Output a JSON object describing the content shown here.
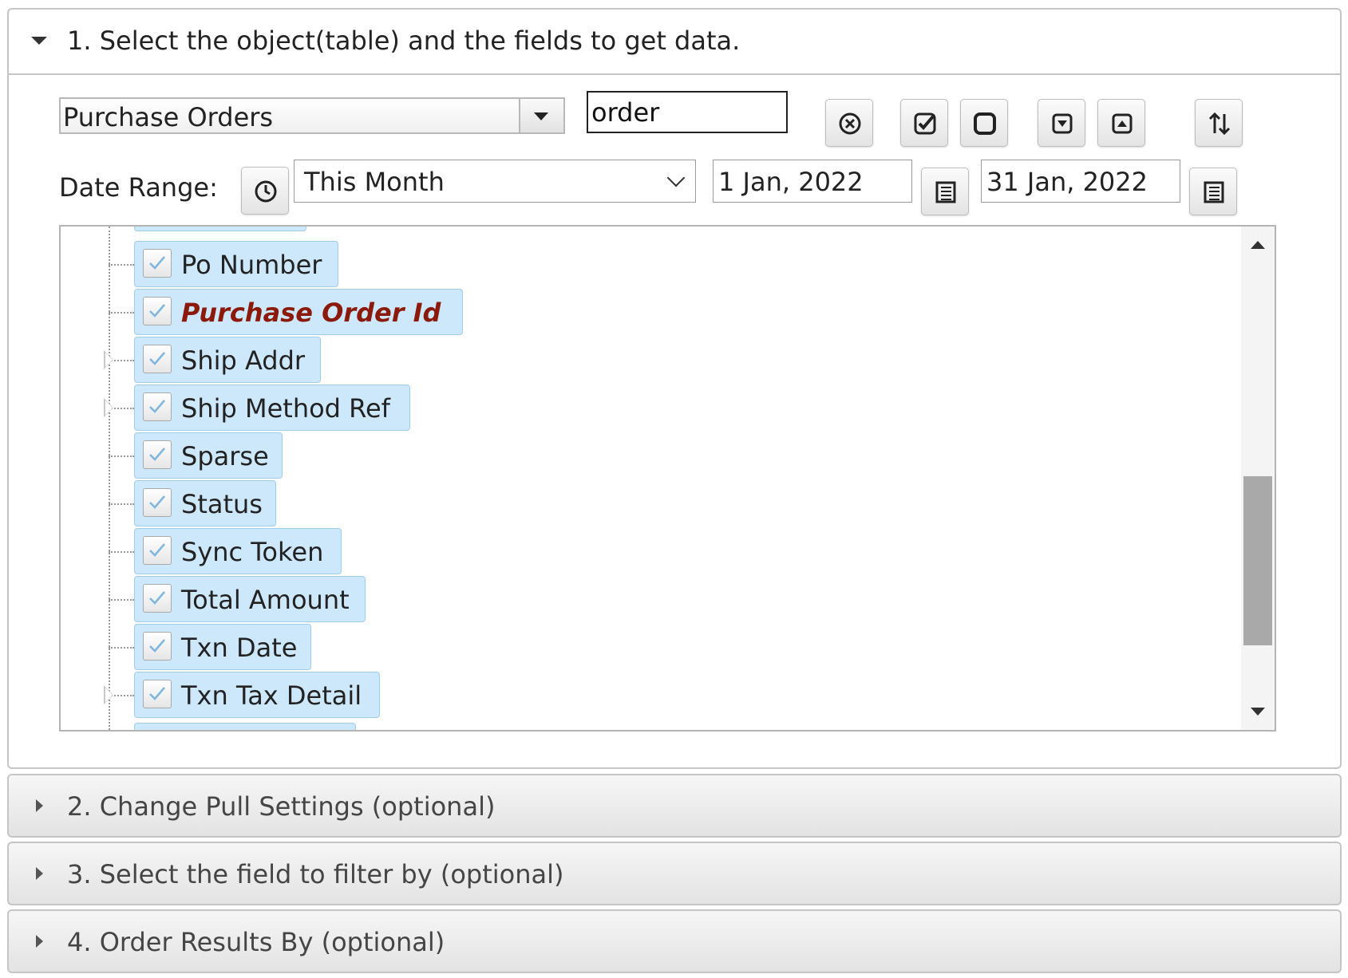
{
  "sections": [
    {
      "title": "1. Select the object(table) and the fields to get data."
    },
    {
      "title": "2. Change Pull Settings (optional)"
    },
    {
      "title": "3. Select the field to filter by (optional)"
    },
    {
      "title": "4. Order Results By (optional)"
    }
  ],
  "object_select": {
    "value": "Purchase Orders"
  },
  "search": {
    "value": "order"
  },
  "date_range": {
    "label": "Date Range:",
    "preset": "This Month",
    "start": "1 Jan, 2022",
    "end": "31 Jan, 2022"
  },
  "toolbar_icons": [
    "clear-search-icon",
    "check-all-icon",
    "uncheck-all-icon",
    "collapse-all-icon",
    "expand-all-icon",
    "sort-icon"
  ],
  "fields": [
    {
      "label": "Po Number",
      "checked": true,
      "expandable": false,
      "key": false
    },
    {
      "label": "Purchase Order Id",
      "checked": true,
      "expandable": false,
      "key": true
    },
    {
      "label": "Ship Addr",
      "checked": true,
      "expandable": true,
      "key": false
    },
    {
      "label": "Ship Method Ref",
      "checked": true,
      "expandable": true,
      "key": false
    },
    {
      "label": "Sparse",
      "checked": true,
      "expandable": false,
      "key": false
    },
    {
      "label": "Status",
      "checked": true,
      "expandable": false,
      "key": false
    },
    {
      "label": "Sync Token",
      "checked": true,
      "expandable": false,
      "key": false
    },
    {
      "label": "Total Amount",
      "checked": true,
      "expandable": false,
      "key": false
    },
    {
      "label": "Txn Date",
      "checked": true,
      "expandable": false,
      "key": false
    },
    {
      "label": "Txn Tax Detail",
      "checked": true,
      "expandable": true,
      "key": false
    }
  ],
  "colors": {
    "field_chip": "#cde8fb",
    "key_field_text": "#8b1a0a",
    "scroll_thumb": "#a9a9a9"
  }
}
